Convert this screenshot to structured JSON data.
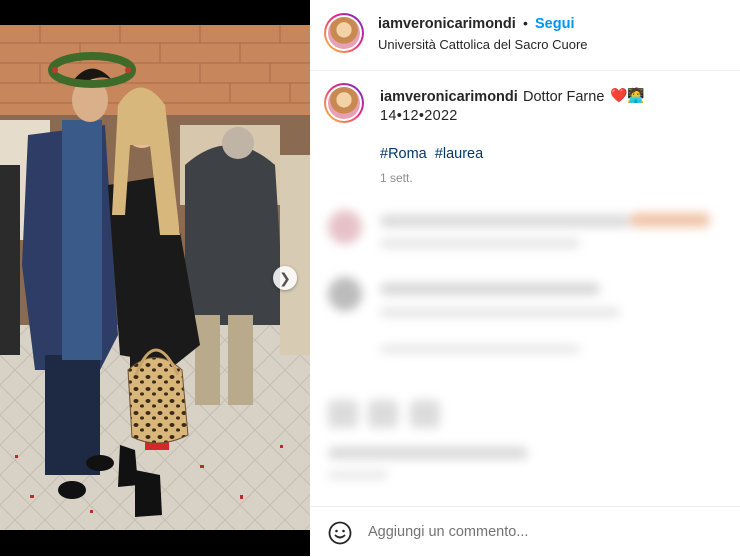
{
  "header": {
    "username": "iamveronicarimondi",
    "separator": "•",
    "follow_label": "Segui",
    "location": "Università Cattolica del Sacro Cuore"
  },
  "caption": {
    "username": "iamveronicarimondi",
    "text": "Dottor Farne",
    "emoji": "❤️🧑‍💻",
    "date": "14•12•2022",
    "hashtags": [
      "#Roma",
      "#laurea"
    ],
    "time_ago": "1 sett."
  },
  "comment_bar": {
    "placeholder": "Aggiungi un commento..."
  },
  "icons": {
    "next": "chevron-right-icon",
    "emoji": "smiley-icon"
  },
  "colors": {
    "follow_blue": "#0095f6",
    "hashtag_blue": "#00376b",
    "muted_gray": "#8e8e8e"
  }
}
